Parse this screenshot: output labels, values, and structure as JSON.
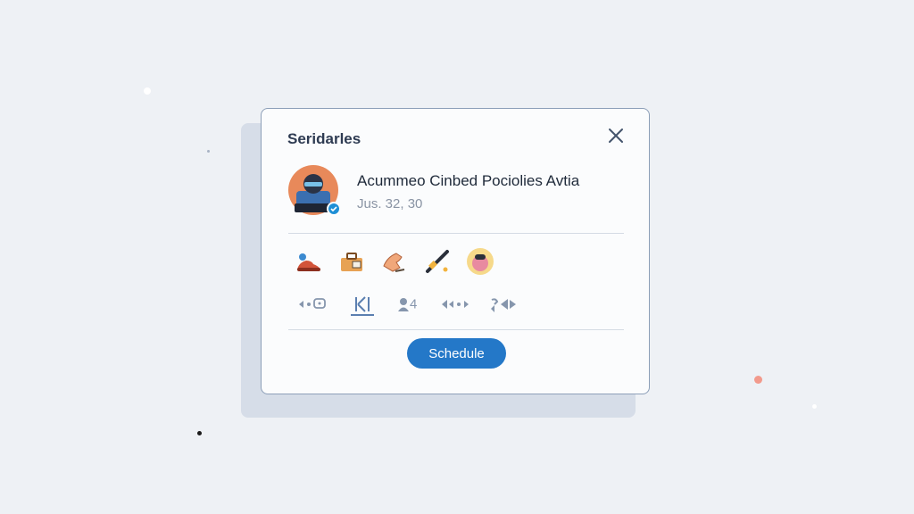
{
  "dialog": {
    "title": "Seridarles",
    "close_icon": "close-icon"
  },
  "post": {
    "title": "Acummeo Cinbed Pociolies Avtia",
    "meta": "Jus. 32, 30",
    "avatar_icon": "avatar-illustration",
    "badge_icon": "verified-badge-icon"
  },
  "reactions": [
    {
      "icon": "red-shoes-icon"
    },
    {
      "icon": "toolbox-icon"
    },
    {
      "icon": "hand-icon"
    },
    {
      "icon": "bat-icon"
    },
    {
      "icon": "pink-character-icon"
    }
  ],
  "toolbar": {
    "items": [
      {
        "icon": "arrow-chat-icon"
      },
      {
        "icon": "keyframe-icon",
        "active": true
      },
      {
        "icon": "user-count-icon",
        "label": "4"
      },
      {
        "icon": "arrows-icon"
      },
      {
        "icon": "swap-icon"
      }
    ]
  },
  "actions": {
    "schedule_label": "Schedule"
  },
  "colors": {
    "accent": "#2478c8",
    "background": "#eef1f5",
    "card_border": "#8d9fb8"
  }
}
